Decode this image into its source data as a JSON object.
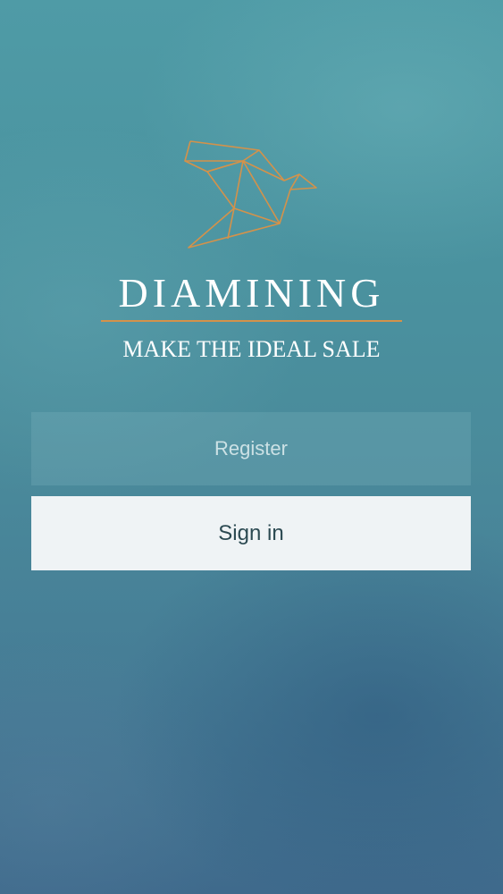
{
  "brand": {
    "logo_icon": "origami-bird-icon",
    "name": "DIAMINING",
    "tagline": "MAKE THE IDEAL SALE",
    "accent_color": "#d4924a"
  },
  "actions": {
    "register_label": "Register",
    "signin_label": "Sign in"
  }
}
